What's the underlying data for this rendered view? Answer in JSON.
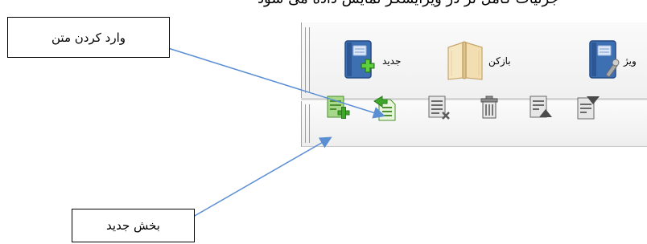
{
  "header_text": "جزئیات کامل تر در ویرایشگر نمایش داده می شود",
  "annotations": {
    "top_label": "وارد کردن متن",
    "bottom_label": "بخش جدید"
  },
  "ribbon": {
    "new_label": "جدید",
    "open_label": "بازکن",
    "tools_label": "ویژ"
  },
  "colors": {
    "arrow": "#5b8fd4",
    "book_blue": "#3d6fb3",
    "green_plus": "#3fa82a"
  },
  "toolbar_icons": [
    "new-section-icon",
    "insert-text-icon",
    "delete-section-icon",
    "trash-icon",
    "move-up-icon",
    "move-down-icon"
  ]
}
